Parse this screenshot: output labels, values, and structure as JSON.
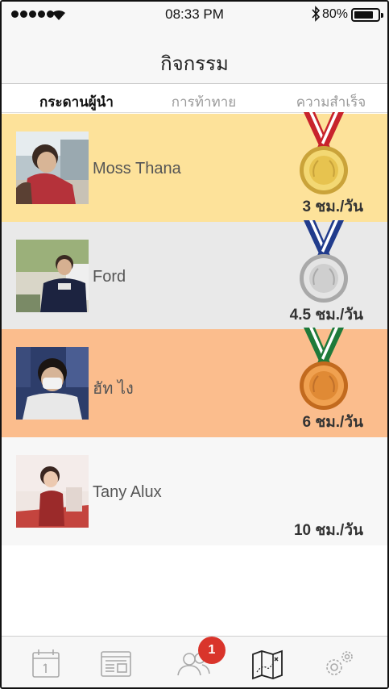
{
  "status_bar": {
    "time": "08:33 PM",
    "battery_percent": "80%",
    "battery_level": 0.8
  },
  "header": {
    "title": "กิจกรรม"
  },
  "tabs": [
    {
      "label": "กระดานผู้นำ",
      "active": true
    },
    {
      "label": "การท้าทาย",
      "active": false
    },
    {
      "label": "ความสำเร็จ",
      "active": false
    }
  ],
  "leaderboard": [
    {
      "rank": 1,
      "name": "Moss Thana",
      "hours": "3 ชม./วัน",
      "medal": "gold",
      "row_color": "#fde29a"
    },
    {
      "rank": 2,
      "name": "Ford",
      "hours": "4.5 ชม./วัน",
      "medal": "silver",
      "row_color": "#e9e9e9"
    },
    {
      "rank": 3,
      "name": "ฮัท ไง",
      "hours": "6 ชม./วัน",
      "medal": "bronze",
      "row_color": "#fbbd8d"
    },
    {
      "rank": 4,
      "name": "Tany Alux",
      "hours": "10 ชม./วัน",
      "medal": "none",
      "row_color": "#f7f7f7"
    }
  ],
  "tab_bar": {
    "items": [
      {
        "icon": "calendar-icon"
      },
      {
        "icon": "news-icon"
      },
      {
        "icon": "friends-icon",
        "badge": "1"
      },
      {
        "icon": "map-icon"
      },
      {
        "icon": "settings-icon"
      }
    ]
  },
  "colors": {
    "badge": "#d9342b",
    "gold_row": "#fde29a",
    "silver_row": "#e9e9e9",
    "bronze_row": "#fbbd8d"
  }
}
